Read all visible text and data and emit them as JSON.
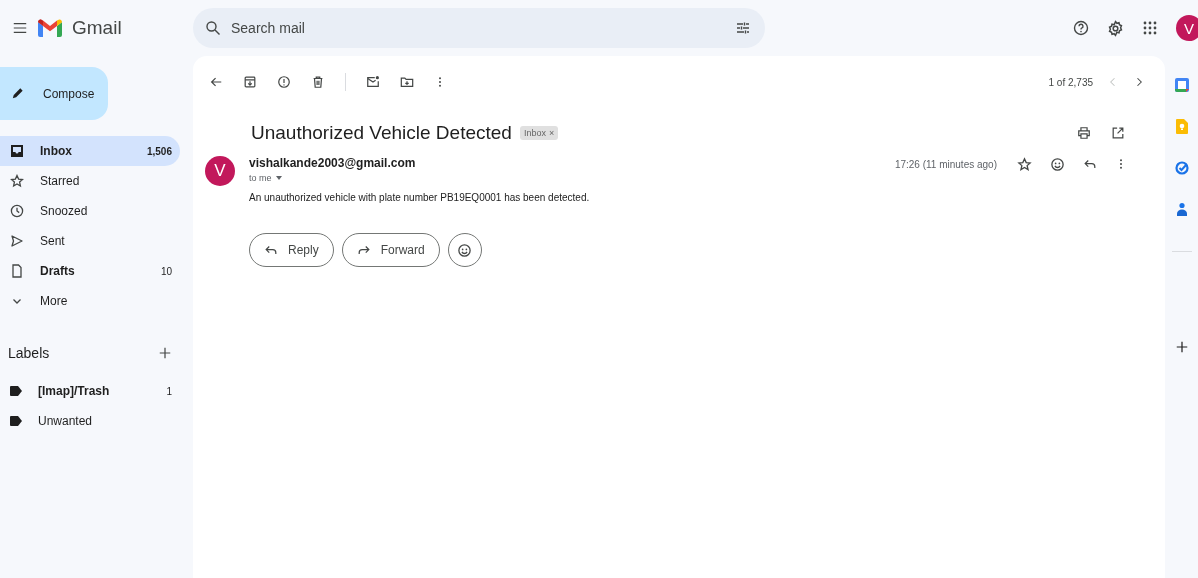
{
  "app": {
    "name": "Gmail"
  },
  "search": {
    "placeholder": "Search mail"
  },
  "account": {
    "initial": "V"
  },
  "compose": {
    "label": "Compose"
  },
  "nav": [
    {
      "label": "Inbox",
      "count": "1,506",
      "selected": true,
      "unread": true
    },
    {
      "label": "Starred",
      "selected": false,
      "unread": false
    },
    {
      "label": "Snoozed",
      "selected": false,
      "unread": false
    },
    {
      "label": "Sent",
      "selected": false,
      "unread": false
    },
    {
      "label": "Drafts",
      "count": "10",
      "selected": false,
      "unread": true
    },
    {
      "label": "More",
      "selected": false,
      "unread": false
    }
  ],
  "labels": {
    "title": "Labels",
    "items": [
      {
        "label": "[Imap]/Trash",
        "count": "1",
        "unread": true
      },
      {
        "label": "Unwanted",
        "unread": false
      }
    ]
  },
  "pager": {
    "text": "1 of 2,735"
  },
  "message": {
    "subject": "Unauthorized Vehicle Detected",
    "tag": "Inbox",
    "tag_remove": "×",
    "avatar": "V",
    "sender": "vishalkande2003@gmail.com",
    "recipient": "to me",
    "time": "17:26 (11 minutes ago)",
    "body": "An unauthorized vehicle with plate number PB19EQ0001 has been detected."
  },
  "actions": [
    {
      "label": "Reply"
    },
    {
      "label": "Forward"
    }
  ]
}
